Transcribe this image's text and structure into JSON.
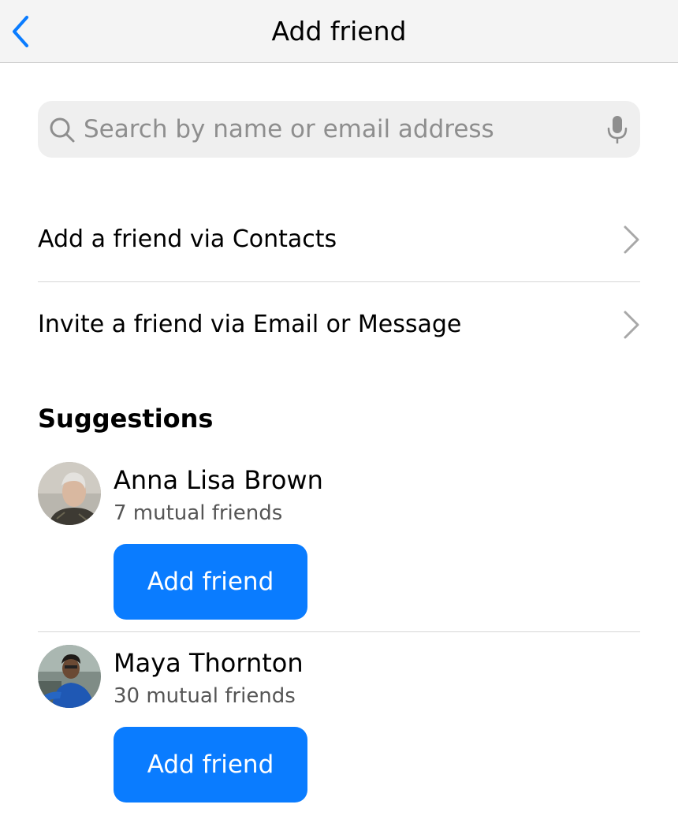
{
  "nav": {
    "title": "Add friend",
    "back_icon": "chevron-left-icon"
  },
  "search": {
    "placeholder": "Search by name or email address",
    "value": "",
    "search_icon": "search-icon",
    "mic_icon": "microphone-icon"
  },
  "actions": [
    {
      "label": "Add a friend via Contacts",
      "icon": "chevron-right-icon"
    },
    {
      "label": "Invite a friend via Email or Message",
      "icon": "chevron-right-icon"
    }
  ],
  "suggestions": {
    "title": "Suggestions",
    "people": [
      {
        "name": "Anna Lisa Brown",
        "mutual": "7 mutual friends",
        "button_label": "Add friend"
      },
      {
        "name": "Maya Thornton",
        "mutual": "30 mutual friends",
        "button_label": "Add friend"
      }
    ]
  },
  "colors": {
    "accent": "#0a7cff",
    "nav_background": "#f4f4f4",
    "search_background": "#efefef",
    "secondary_text": "#555555",
    "divider": "#d6d6d6"
  }
}
